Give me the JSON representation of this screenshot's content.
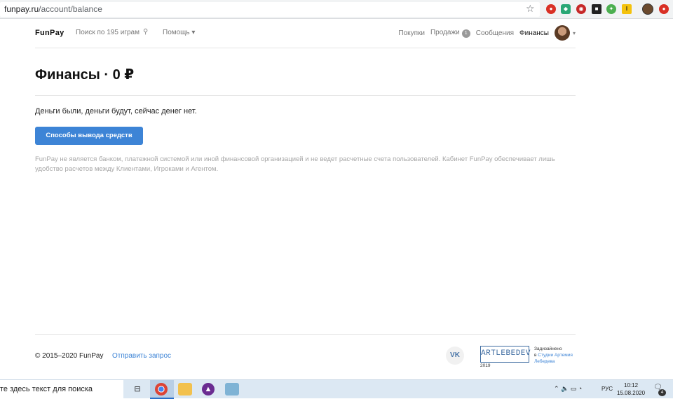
{
  "browser": {
    "url_host": "funpay.ru",
    "url_path": "/account/balance"
  },
  "header": {
    "logo": "FunPay",
    "search_placeholder": "Поиск по 195 играм",
    "help_label": "Помощь",
    "nav": {
      "purchases": "Покупки",
      "sales": "Продажи",
      "sales_count": "1",
      "messages": "Сообщения",
      "finances": "Финансы"
    }
  },
  "main": {
    "title": "Финансы · 0 ₽",
    "message": "Деньги были, деньги будут, сейчас денег нет.",
    "withdraw_button": "Способы вывода средств",
    "disclaimer": "FunPay не является банком, платежной системой или иной финансовой организацией и не ведет расчетные счета пользователей. Кабинет FunPay обеспечивает лишь удобство расчетов между Клиентами, Игроками и Агентом."
  },
  "footer": {
    "copyright": "© 2015–2020 FunPay",
    "feedback_link": "Отправить запрос",
    "vk_label": "VK",
    "studio_logo": "ARTLEBEDEV",
    "studio_year": "2019",
    "designed_line1": "Задизайнено",
    "designed_line2_prefix": "в ",
    "designed_link": "Студии Артемия Лебедева"
  },
  "taskbar": {
    "search_placeholder": "те здесь текст для поиска",
    "language": "РУС",
    "time": "10:12",
    "date": "15.08.2020",
    "notifications_count": "4"
  }
}
